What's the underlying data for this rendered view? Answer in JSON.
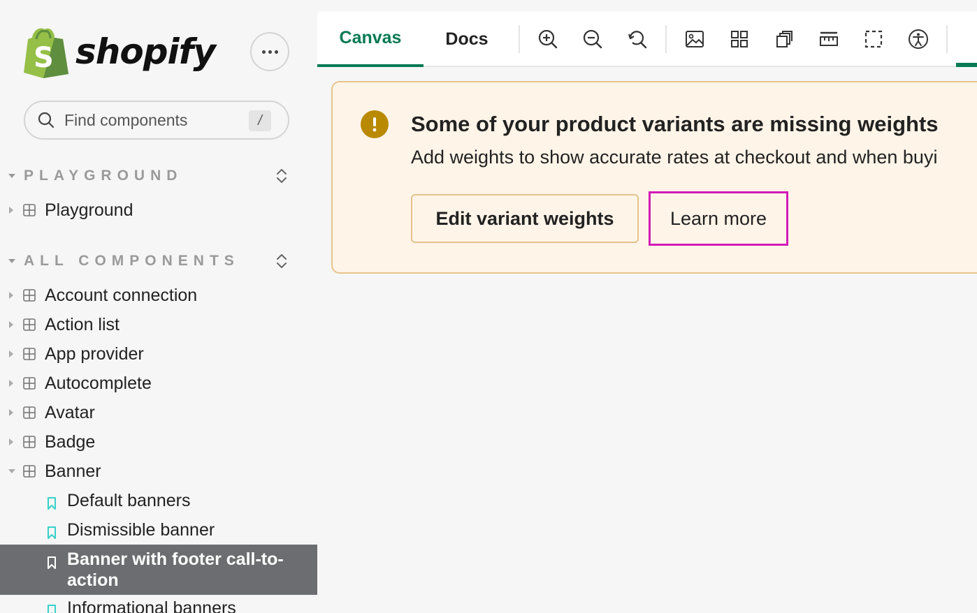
{
  "brand": {
    "name": "shopify",
    "logo_letter": "S",
    "logo_color": "#95bf47"
  },
  "sidebar": {
    "search": {
      "placeholder": "Find components",
      "shortcut": "/"
    },
    "sections": [
      {
        "title": "PLAYGROUND"
      },
      {
        "title": "ALL COMPONENTS"
      }
    ],
    "playground_items": [
      {
        "label": "Playground"
      }
    ],
    "components": [
      {
        "label": "Account connection"
      },
      {
        "label": "Action list"
      },
      {
        "label": "App provider"
      },
      {
        "label": "Autocomplete"
      },
      {
        "label": "Avatar"
      },
      {
        "label": "Badge"
      },
      {
        "label": "Banner",
        "expanded": true
      }
    ],
    "banner_children": [
      {
        "label": "Default banners"
      },
      {
        "label": "Dismissible banner"
      },
      {
        "label": "Banner with footer call-to-action",
        "active": true
      },
      {
        "label": "Informational banners"
      }
    ]
  },
  "toolbar": {
    "tabs": [
      {
        "label": "Canvas",
        "active": true
      },
      {
        "label": "Docs"
      }
    ],
    "icons": [
      "zoom-in-icon",
      "zoom-out-icon",
      "reset-zoom-icon",
      "background-icon",
      "grid-icon",
      "outline-icon",
      "measure-icon",
      "viewport-icon",
      "accessibility-icon"
    ]
  },
  "banner": {
    "status": "warning",
    "title": "Some of your product variants are missing weights",
    "body": "Add weights to show accurate rates at checkout and when buyi",
    "primary_action": "Edit variant weights",
    "secondary_action": "Learn more"
  },
  "colors": {
    "accent": "#0a7a55",
    "warning": "#b98900",
    "highlight": "#d21ab8",
    "active_bg": "#6b6d70"
  }
}
